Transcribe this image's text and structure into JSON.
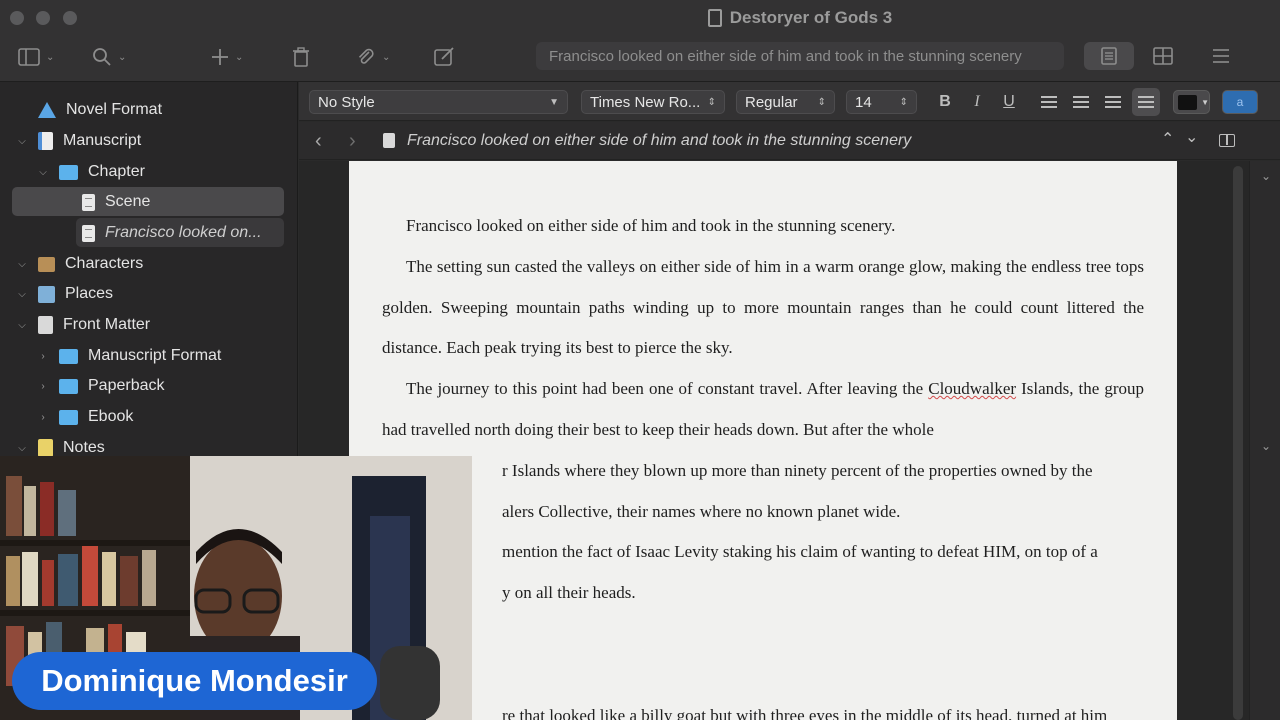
{
  "window": {
    "title": "Destoryer of Gods 3"
  },
  "toolbar": {
    "search_text": "Francisco looked on either side of him and took in the stunning scenery",
    "icons": [
      "sidebar-icon",
      "search-icon",
      "add-icon",
      "trash-icon",
      "paperclip-icon",
      "compose-icon",
      "document-view-icon",
      "grid-view-icon",
      "menu-icon"
    ]
  },
  "binder": {
    "items": [
      {
        "label": "Novel Format",
        "icon": "warning-icon",
        "level": 0
      },
      {
        "label": "Manuscript",
        "icon": "manuscript-icon",
        "level": 0
      },
      {
        "label": "Chapter",
        "icon": "folder-icon",
        "level": 1
      },
      {
        "label": "Scene",
        "icon": "document-icon",
        "level": 2
      },
      {
        "label": "Francisco looked on...",
        "icon": "document-icon",
        "level": 2
      },
      {
        "label": "Characters",
        "icon": "characters-icon",
        "level": 0
      },
      {
        "label": "Places",
        "icon": "places-icon",
        "level": 0
      },
      {
        "label": "Front Matter",
        "icon": "front-matter-icon",
        "level": 0
      },
      {
        "label": "Manuscript Format",
        "icon": "folder-icon",
        "level": 1
      },
      {
        "label": "Paperback",
        "icon": "folder-icon",
        "level": 1
      },
      {
        "label": "Ebook",
        "icon": "folder-icon",
        "level": 1
      },
      {
        "label": "Notes",
        "icon": "notes-icon",
        "level": 0
      }
    ]
  },
  "format": {
    "style": "No Style",
    "font": "Times New Ro...",
    "weight": "Regular",
    "size": "14",
    "bold": "B",
    "italic": "I",
    "underline": "U",
    "highlight_letter": "a",
    "text_color": "#111111",
    "highlight_color": "#2e6db0"
  },
  "header": {
    "title": "Francisco looked on either side of him and took in the stunning scenery"
  },
  "document": {
    "p1": "Francisco looked on either side of him and took in the stunning scenery.",
    "p2": "The setting sun casted the valleys on either side of him in a warm orange glow, making the endless tree tops golden. Sweeping mountain paths winding up to more mountain ranges than he could count littered the distance. Each peak trying its best to pierce the sky.",
    "p3a": "The journey to this point had been one of constant travel. After leaving the ",
    "p3_misspelled": "Cloudwalker",
    "p3b": " Islands, the group had travelled north doing their best to keep their heads down. But after the whole",
    "p4": "r Islands where they blown up more than ninety percent of the properties owned by the",
    "p5": "alers Collective,  their names where no known planet wide.",
    "p6": "mention the fact of Isaac Levity staking his claim of wanting to defeat HIM, on top of a",
    "p7": "y on all their heads.",
    "p8": "re that looked like a billy goat but with three eyes in the middle of its head, turned at him"
  },
  "presenter": {
    "name": "Dominique Mondesir"
  }
}
